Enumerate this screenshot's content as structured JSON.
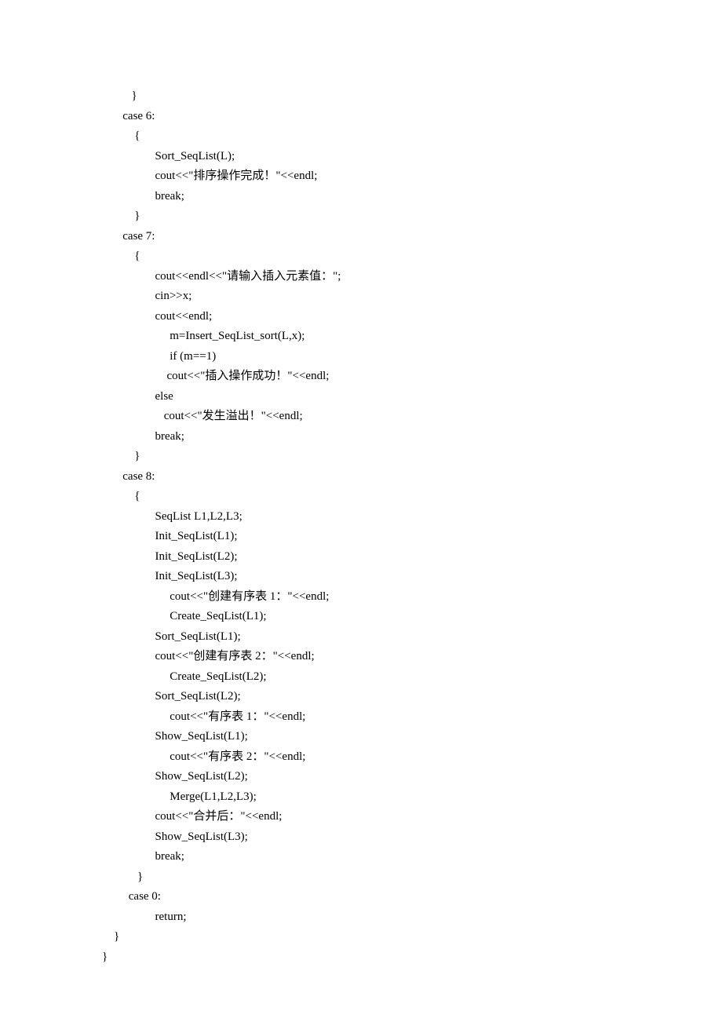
{
  "code_lines": [
    "          }",
    "       case 6:",
    "           {",
    "                  Sort_SeqList(L);",
    "                  cout<<\"排序操作完成！\"<<endl;",
    "                  break;",
    "           }",
    "       case 7:",
    "           {",
    "                  cout<<endl<<\"请输入插入元素值：\";",
    "                  cin>>x;",
    "                  cout<<endl;",
    "                       m=Insert_SeqList_sort(L,x);",
    "                       if (m==1)",
    "                      cout<<\"插入操作成功！\"<<endl;",
    "                  else",
    "                     cout<<\"发生溢出！\"<<endl;",
    "                  break;",
    "           }",
    "       case 8:",
    "           {",
    "                  SeqList L1,L2,L3;",
    "                  Init_SeqList(L1);",
    "                  Init_SeqList(L2);",
    "                  Init_SeqList(L3);",
    "                       cout<<\"创建有序表 1：\"<<endl;",
    "                       Create_SeqList(L1);",
    "                  Sort_SeqList(L1);",
    "                  cout<<\"创建有序表 2：\"<<endl;",
    "                       Create_SeqList(L2);",
    "                  Sort_SeqList(L2);",
    "                       cout<<\"有序表 1：\"<<endl;",
    "                  Show_SeqList(L1);",
    "                       cout<<\"有序表 2：\"<<endl;",
    "                  Show_SeqList(L2);",
    "                       Merge(L1,L2,L3);",
    "                  cout<<\"合并后：\"<<endl;",
    "                  Show_SeqList(L3);",
    "                  break;",
    "            }",
    "         case 0:",
    "                  return;",
    "    }",
    "}"
  ]
}
